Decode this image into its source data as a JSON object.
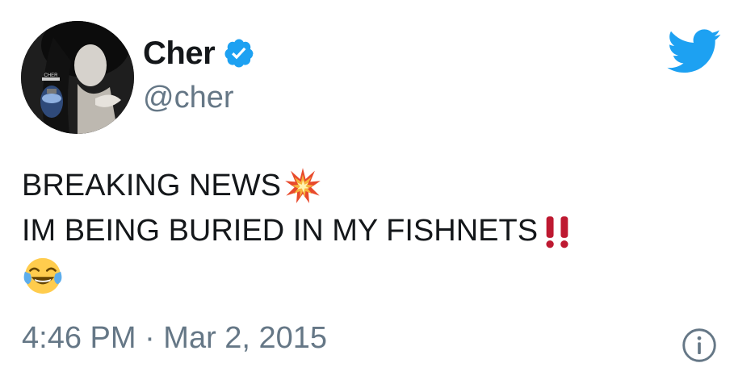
{
  "user": {
    "name": "Cher",
    "handle": "@cher",
    "avatar_caption": "CHER"
  },
  "tweet": {
    "lines": [
      "BREAKING NEWS",
      "IM BEING BURIED IN MY FISHNETS"
    ],
    "emojis": [
      "collision-icon",
      "double-exclamation-icon",
      "tears-of-joy-icon"
    ]
  },
  "meta": {
    "timestamp": "4:46 PM · Mar 2, 2015"
  },
  "colors": {
    "twitter_blue": "#1da1f2",
    "text": "#14171a",
    "muted": "#657786",
    "exclamation_red": "#be1931"
  }
}
